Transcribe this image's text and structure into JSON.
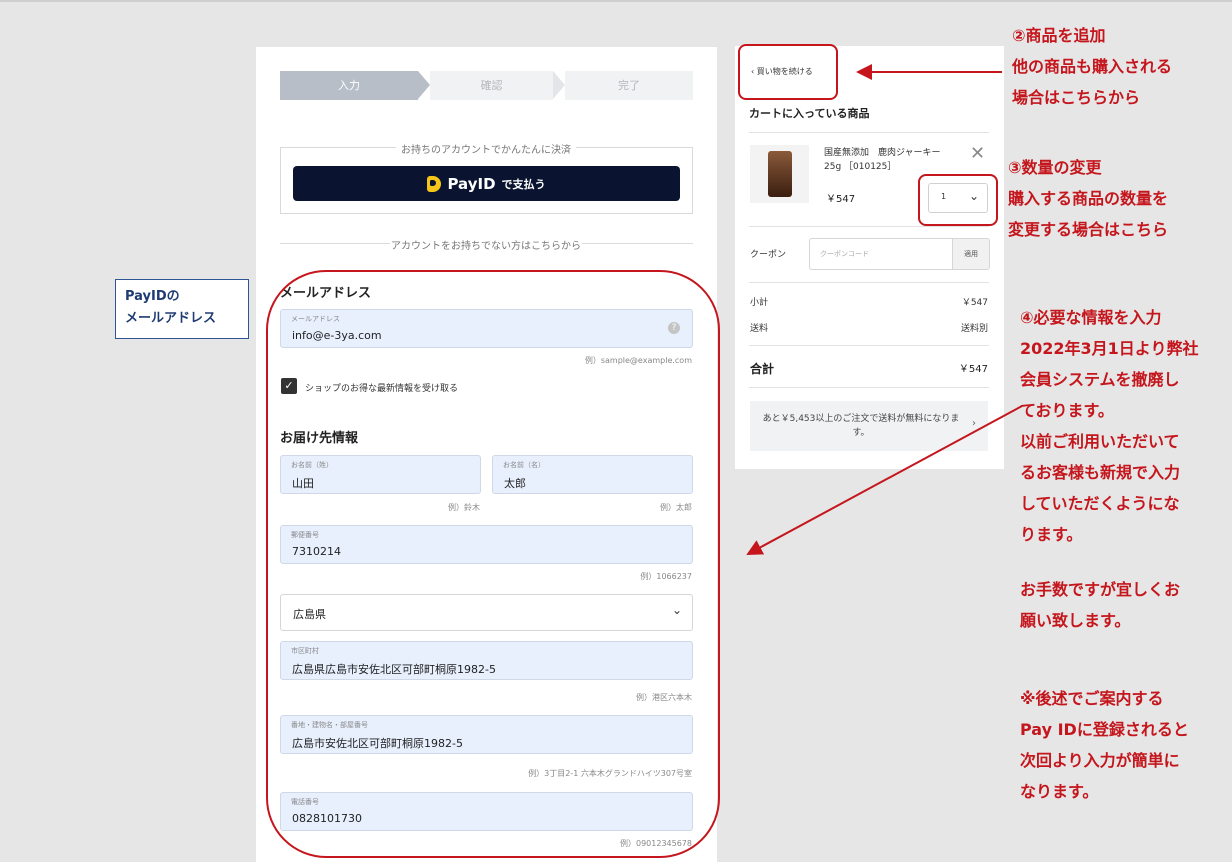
{
  "steps": [
    "入力",
    "確認",
    "完了"
  ],
  "quick_pay": {
    "title": "お持ちのアカウントでかんたんに決済",
    "button_name": "PayID",
    "button_suffix": "で支払う"
  },
  "no_account_text": "アカウントをお持ちでない方はこちらから",
  "email_section": {
    "title": "メールアドレス",
    "field_label": "メールアドレス",
    "value": "info@e-3ya.com",
    "hint": "例）sample@example.com",
    "help_icon": "question-icon"
  },
  "newsletter": {
    "checked": true,
    "label": "ショップのお得な最新情報を受け取る"
  },
  "delivery": {
    "title": "お届け先情報",
    "last_name": {
      "label": "お名前（姓）",
      "value": "山田",
      "hint": "例）鈴木"
    },
    "first_name": {
      "label": "お名前（名）",
      "value": "太郎",
      "hint": "例）太郎"
    },
    "postal": {
      "label": "郵便番号",
      "value": "7310214",
      "hint": "例）1066237"
    },
    "prefecture": {
      "value": "広島県"
    },
    "city": {
      "label": "市区町村",
      "value": "広島県広島市安佐北区可部町桐原1982-5",
      "hint": "例）港区六本木"
    },
    "address": {
      "label": "番地・建物名・部屋番号",
      "value": "広島市安佐北区可部町桐原1982-5",
      "hint": "例）3丁目2-1 六本木グランドハイツ307号室"
    },
    "phone": {
      "label": "電話番号",
      "value": "0828101730",
      "hint": "例）09012345678"
    }
  },
  "cart": {
    "continue_label": "買い物を続ける",
    "title": "カートに入っている商品",
    "product": {
      "name": "国産無添加　鹿肉ジャーキー 25g ［010125］",
      "price": "￥547",
      "qty": "1"
    },
    "coupon": {
      "label": "クーポン",
      "placeholder": "クーポンコード",
      "button": "適用"
    },
    "subtotal": {
      "label": "小計",
      "value": "￥547"
    },
    "shipping": {
      "label": "送料",
      "value": "送料別"
    },
    "total": {
      "label": "合計",
      "value": "￥547"
    },
    "free_shipping_msg": "あと￥5,453以上のご注文で送料が無料になります。"
  },
  "annotations": {
    "payid_box": "PayIDの\nメールアドレス",
    "note2": "②商品を追加\n他の商品も購入される\n場合はこちらから",
    "note3": "③数量の変更\n購入する商品の数量を\n変更する場合はこちら",
    "note4": "④必要な情報を入力\n2022年3月1日より弊社\n会員システムを撤廃し\nております。\n以前ご利用いただいて\nるお客様も新規で入力\nしていただくようにな\nります。",
    "note_thanks": "お手数ですが宜しくお\n願い致します。",
    "note_payid": "※後述でご案内する\nPay IDに登録されると\n次回より入力が簡単に\nなります。"
  },
  "colors": {
    "annotation_red": "#c4161c",
    "payid_navy": "#0a1430",
    "field_bg": "#e8f0fe"
  }
}
